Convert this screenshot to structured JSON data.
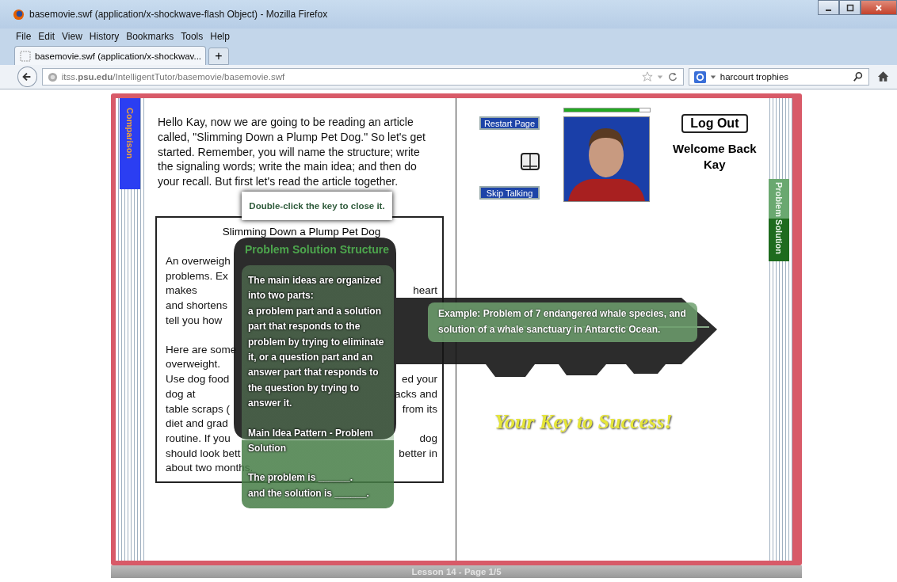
{
  "window": {
    "title": "basemovie.swf (application/x-shockwave-flash Object) - Mozilla Firefox"
  },
  "menu": [
    "File",
    "Edit",
    "View",
    "History",
    "Bookmarks",
    "Tools",
    "Help"
  ],
  "tabs": [
    {
      "label": "basemovie.swf (application/x-shockwav...",
      "selected": true
    }
  ],
  "new_tab": "+",
  "address": {
    "url": "itss.**psu.edu**/IntelligentTutor/basemovie/basemovie.swf"
  },
  "search": {
    "value": "harcourt trophies"
  },
  "book": {
    "left_tab": "Comparison",
    "right_tab": "Problem Solution",
    "intro": "Hello Kay, now we are going to be reading an article called, \"Slimming Down a Plump Pet Dog.\" So let's get started. Remember, you will name the structure; write the signaling words; write the main idea; and then do your recall. But first let's read the article together.",
    "article": {
      "title": "Slimming Down a Plump Pet Dog",
      "paragraphs": [
        [
          {
            "left": "An overweigh"
          },
          {
            "left": "problems. Ex"
          },
          {
            "left": "makes",
            "right": "heart"
          },
          {
            "left": "and shortens"
          },
          {
            "left": "tell you how"
          }
        ],
        [
          {
            "left": "Here are some"
          },
          {
            "left": "overweight."
          },
          {
            "left": "Use dog food",
            "right": "ed your"
          },
          {
            "left": "dog at",
            "right": "acks and"
          },
          {
            "left": "table scraps (",
            "right": "from its"
          },
          {
            "left": "diet and grad"
          },
          {
            "left": "routine. If you",
            "right": "dog"
          },
          {
            "left": "should look bett",
            "right": "better in"
          },
          {
            "left": "about two months."
          }
        ]
      ]
    },
    "restart_button": "Restart Page",
    "skip_button": "Skip Talking",
    "logout_button": "Log Out",
    "speech_progress": {
      "level": 0.88
    },
    "welcome": [
      "Welcome Back",
      "Kay"
    ],
    "footer": "Lesson 14 - Page 1/5"
  },
  "key": {
    "hint": "Double-click the key to close it.",
    "title": "Problem Solution Structure",
    "description": [
      "The main ideas are organized into two parts:",
      "a problem part and a solution part that responds to the problem by trying to eliminate it, or a question part and an answer part that responds to the question by trying to answer it."
    ],
    "pattern": "Main Idea Pattern - Problem Solution",
    "frames": [
      "The problem is ______.",
      "and the solution is ______."
    ],
    "example": "Example: Problem of 7 endangered whale species, and solution of a whale sanctuary in Antarctic Ocean.",
    "slogan": "Your Key to Success!"
  }
}
